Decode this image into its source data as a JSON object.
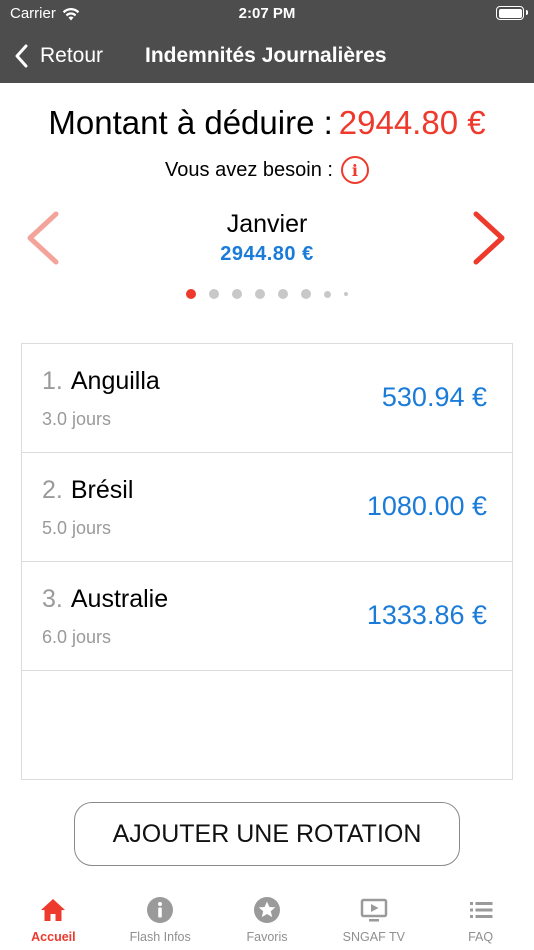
{
  "status": {
    "carrier": "Carrier",
    "time": "2:07 PM"
  },
  "nav": {
    "back_label": "Retour",
    "title": "Indemnités Journalières"
  },
  "summary": {
    "label": "Montant à déduire :",
    "value": "2944.80 €",
    "need_label": "Vous avez besoin :"
  },
  "month": {
    "name": "Janvier",
    "amount": "2944.80 €"
  },
  "pagination": {
    "total": 8,
    "current": 1
  },
  "rows": [
    {
      "num": "1.",
      "name": "Anguilla",
      "days": "3.0 jours",
      "amount": "530.94 €"
    },
    {
      "num": "2.",
      "name": "Brésil",
      "days": "5.0 jours",
      "amount": "1080.00 €"
    },
    {
      "num": "3.",
      "name": "Australie",
      "days": "6.0 jours",
      "amount": "1333.86 €"
    }
  ],
  "add_button_label": "AJOUTER UNE ROTATION",
  "tabs": [
    {
      "label": "Accueil",
      "icon": "home-icon",
      "active": true
    },
    {
      "label": "Flash Infos",
      "icon": "info-icon",
      "active": false
    },
    {
      "label": "Favoris",
      "icon": "star-icon",
      "active": false
    },
    {
      "label": "SNGAF TV",
      "icon": "tv-icon",
      "active": false
    },
    {
      "label": "FAQ",
      "icon": "list-icon",
      "active": false
    }
  ],
  "colors": {
    "accent_red": "#ee3a2c",
    "accent_blue": "#1a7bd8",
    "nav_bg": "#4d4d4d"
  }
}
